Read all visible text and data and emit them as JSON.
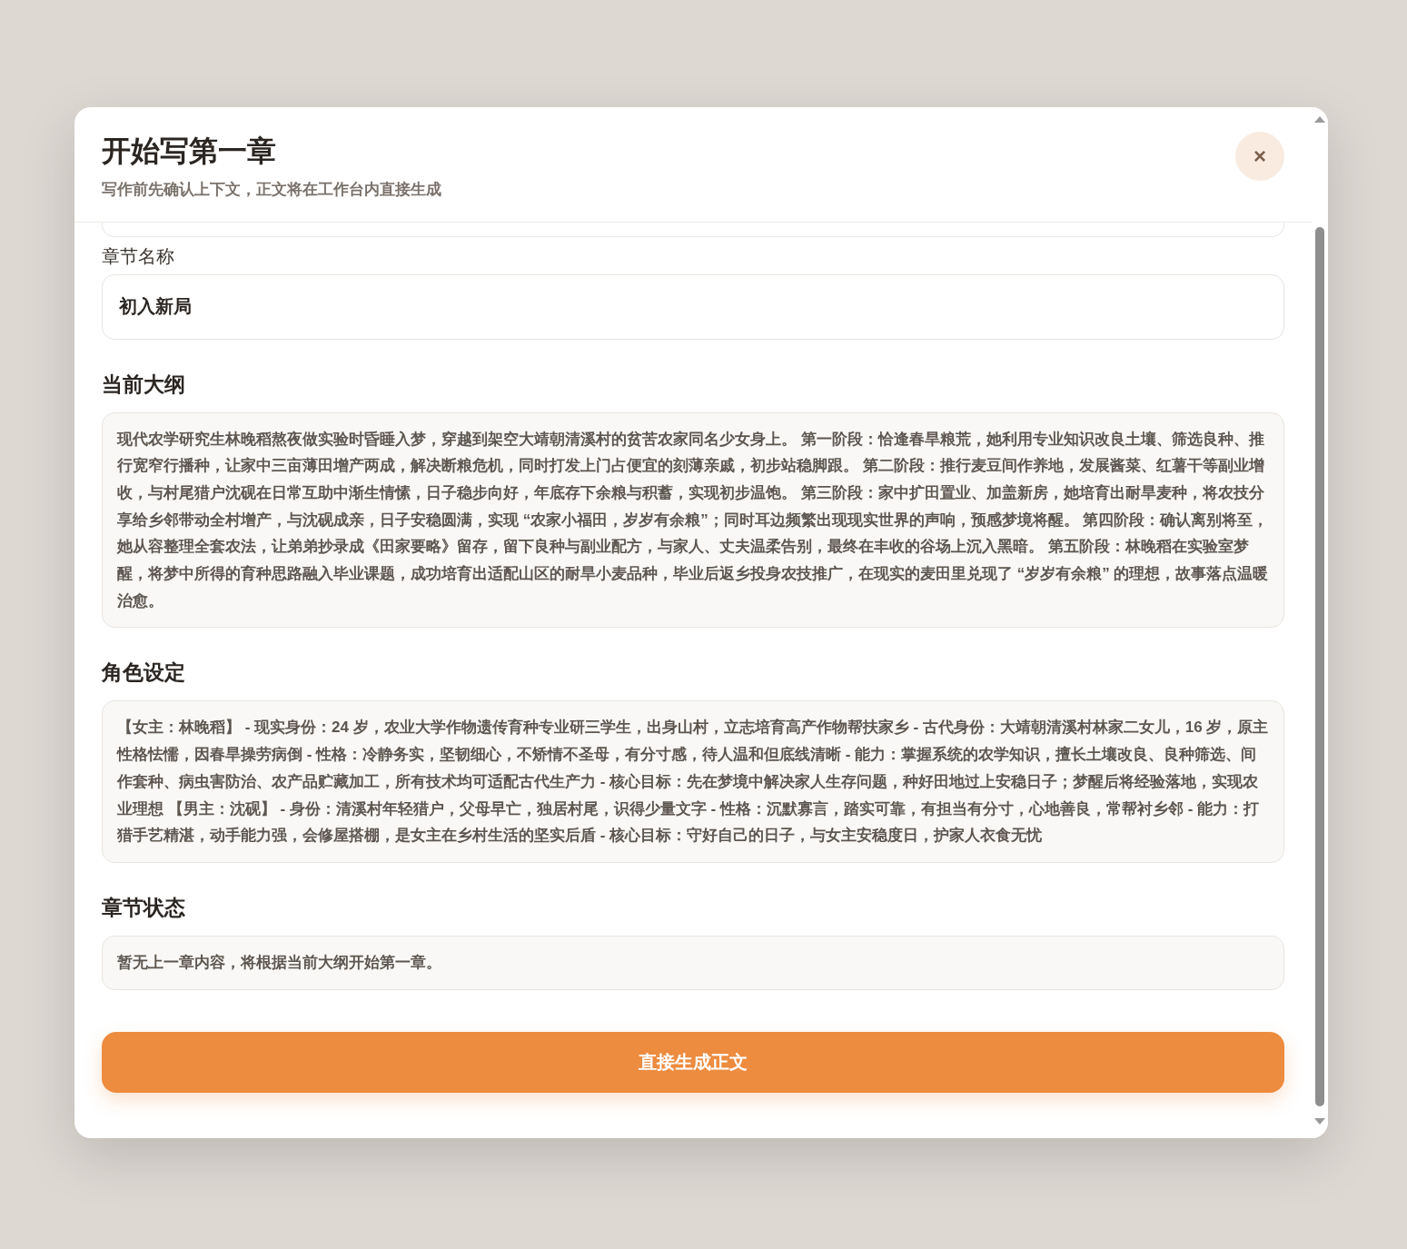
{
  "dialog": {
    "title": "开始写第一章",
    "subtitle": "写作前先确认上下文，正文将在工作台内直接生成",
    "close": "×"
  },
  "chapter_name": {
    "label": "章节名称",
    "value": "初入新局"
  },
  "sections": [
    {
      "heading": "当前大纲",
      "text": "现代农学研究生林晚稻熬夜做实验时昏睡入梦，穿越到架空大靖朝清溪村的贫苦农家同名少女身上。 第一阶段：恰逢春旱粮荒，她利用专业知识改良土壤、筛选良种、推行宽窄行播种，让家中三亩薄田增产两成，解决断粮危机，同时打发上门占便宜的刻薄亲戚，初步站稳脚跟。 第二阶段：推行麦豆间作养地，发展酱菜、红薯干等副业增收，与村尾猎户沈砚在日常互助中渐生情愫，日子稳步向好，年底存下余粮与积蓄，实现初步温饱。 第三阶段：家中扩田置业、加盖新房，她培育出耐旱麦种，将农技分享给乡邻带动全村增产，与沈砚成亲，日子安稳圆满，实现 “农家小福田，岁岁有余粮”；同时耳边频繁出现现实世界的声响，预感梦境将醒。 第四阶段：确认离别将至，她从容整理全套农法，让弟弟抄录成《田家要略》留存，留下良种与副业配方，与家人、丈夫温柔告别，最终在丰收的谷场上沉入黑暗。 第五阶段：林晚稻在实验室梦醒，将梦中所得的育种思路融入毕业课题，成功培育出适配山区的耐旱小麦品种，毕业后返乡投身农技推广，在现实的麦田里兑现了 “岁岁有余粮” 的理想，故事落点温暖治愈。"
    },
    {
      "heading": "角色设定",
      "text": "【女主：林晚稻】 - 现实身份：24 岁，农业大学作物遗传育种专业研三学生，出身山村，立志培育高产作物帮扶家乡 - 古代身份：大靖朝清溪村林家二女儿，16 岁，原主性格怯懦，因春旱操劳病倒 - 性格：冷静务实，坚韧细心，不矫情不圣母，有分寸感，待人温和但底线清晰 - 能力：掌握系统的农学知识，擅长土壤改良、良种筛选、间作套种、病虫害防治、农产品贮藏加工，所有技术均可适配古代生产力 - 核心目标：先在梦境中解决家人生存问题，种好田地过上安稳日子；梦醒后将经验落地，实现农业理想 【男主：沈砚】 - 身份：清溪村年轻猎户，父母早亡，独居村尾，识得少量文字 - 性格：沉默寡言，踏实可靠，有担当有分寸，心地善良，常帮衬乡邻 - 能力：打猎手艺精湛，动手能力强，会修屋搭棚，是女主在乡村生活的坚实后盾 - 核心目标：守好自己的日子，与女主安稳度日，护家人衣食无忧"
    },
    {
      "heading": "章节状态",
      "text": "暂无上一章内容，将根据当前大纲开始第一章。"
    }
  ],
  "submit_button": "直接生成正文"
}
